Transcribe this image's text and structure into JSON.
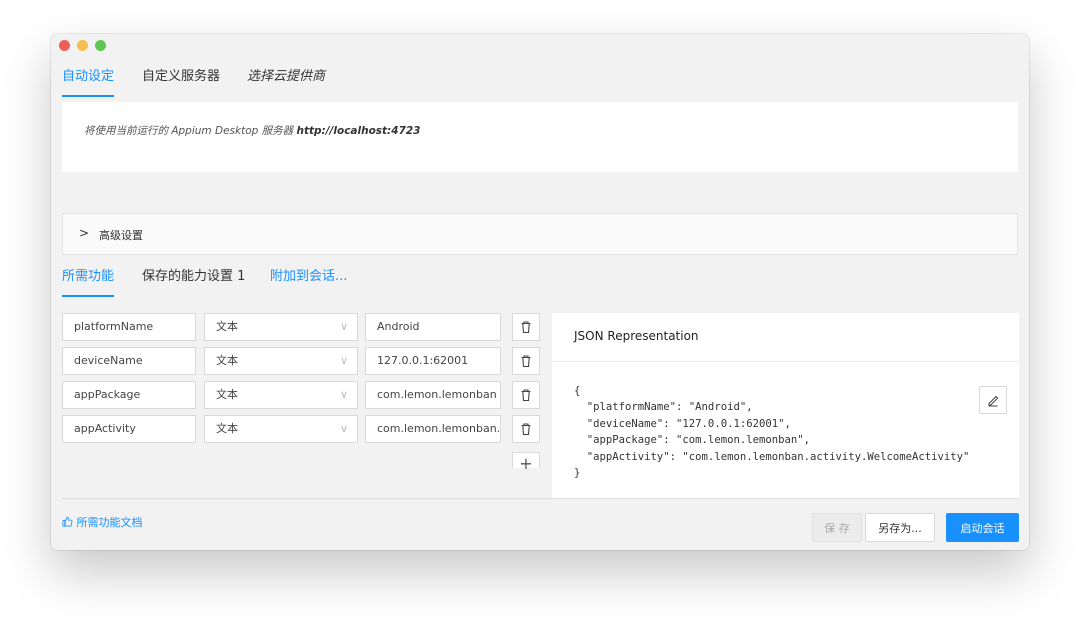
{
  "top_tabs": [
    {
      "label": "自动设定",
      "active": true
    },
    {
      "label": "自定义服务器",
      "active": false
    },
    {
      "label": "选择云提供商",
      "active": false
    }
  ],
  "server": {
    "text_prefix": "将使用当前运行的 Appium Desktop 服务器",
    "url": "http://localhost:4723"
  },
  "advanced": {
    "label": "高级设置"
  },
  "cap_tabs": [
    {
      "label": "所需功能",
      "active": true
    },
    {
      "label": "保存的能力设置 1",
      "active": false
    },
    {
      "label": "附加到会话...",
      "active": false,
      "link": true
    }
  ],
  "capabilities": [
    {
      "name": "platformName",
      "type": "文本",
      "value": "Android"
    },
    {
      "name": "deviceName",
      "type": "文本",
      "value": "127.0.0.1:62001"
    },
    {
      "name": "appPackage",
      "type": "文本",
      "value": "com.lemon.lemonban"
    },
    {
      "name": "appActivity",
      "type": "文本",
      "value": "com.lemon.lemonban.a"
    }
  ],
  "json_panel": {
    "title": "JSON Representation",
    "code": "{\n  \"platformName\": \"Android\",\n  \"deviceName\": \"127.0.0.1:62001\",\n  \"appPackage\": \"com.lemon.lemonban\",\n  \"appActivity\": \"com.lemon.lemonban.activity.WelcomeActivity\"\n}"
  },
  "footer": {
    "doc_link": "所需功能文档",
    "save": "保 存",
    "save_as": "另存为...",
    "start": "启动会话"
  },
  "colors": {
    "accent": "#1890ff",
    "window_bg": "#f2f2f2"
  }
}
